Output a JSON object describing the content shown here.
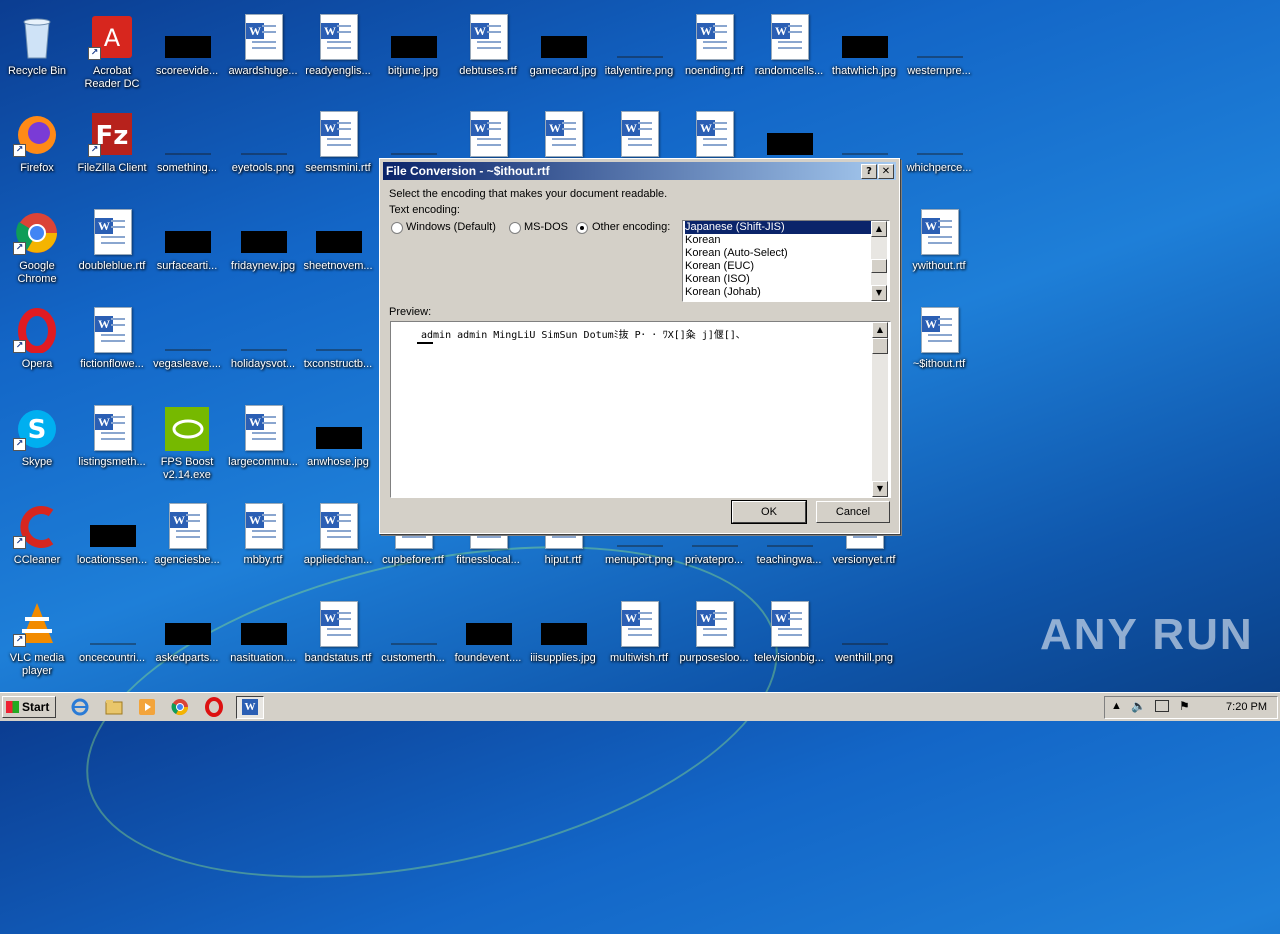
{
  "desktop": {
    "icons": [
      {
        "label": "Recycle Bin",
        "type": "recycle"
      },
      {
        "label": "Acrobat\nReader DC",
        "type": "acrobat"
      },
      {
        "label": "scoreevide...",
        "type": "black"
      },
      {
        "label": "awardshuge...",
        "type": "word"
      },
      {
        "label": "readyenglis...",
        "type": "word"
      },
      {
        "label": "bitjune.jpg",
        "type": "black"
      },
      {
        "label": "debtuses.rtf",
        "type": "word"
      },
      {
        "label": "gamecard.jpg",
        "type": "black"
      },
      {
        "label": "italyentire.png",
        "type": "thin"
      },
      {
        "label": "noending.rtf",
        "type": "word"
      },
      {
        "label": "randomcells...",
        "type": "word"
      },
      {
        "label": "thatwhich.jpg",
        "type": "black"
      },
      {
        "label": "westernpre...",
        "type": "thin"
      },
      {
        "label": "Firefox",
        "type": "firefox"
      },
      {
        "label": "FileZilla Client",
        "type": "filezilla"
      },
      {
        "label": "something...",
        "type": "thin"
      },
      {
        "label": "eyetools.png",
        "type": "thin"
      },
      {
        "label": "seemsmini.rtf",
        "type": "word"
      },
      {
        "label": "",
        "type": "thin"
      },
      {
        "label": "",
        "type": "word"
      },
      {
        "label": "",
        "type": "word"
      },
      {
        "label": "",
        "type": "word"
      },
      {
        "label": "",
        "type": "word"
      },
      {
        "label": "",
        "type": "black"
      },
      {
        "label": "",
        "type": "thin"
      },
      {
        "label": "whichperce...",
        "type": "thin"
      },
      {
        "label": "Google\nChrome",
        "type": "chrome"
      },
      {
        "label": "doubleblue.rtf",
        "type": "word"
      },
      {
        "label": "surfacearti...",
        "type": "black"
      },
      {
        "label": "fridaynew.jpg",
        "type": "black"
      },
      {
        "label": "sheetnovem...",
        "type": "black"
      },
      {
        "label": "ywithout.rtf",
        "type": "word"
      },
      {
        "label": "Opera",
        "type": "opera"
      },
      {
        "label": "fictionflowe...",
        "type": "word"
      },
      {
        "label": "vegasleave....",
        "type": "thin"
      },
      {
        "label": "holidaysvot...",
        "type": "thin"
      },
      {
        "label": "txconstructb...",
        "type": "thin"
      },
      {
        "label": "~$ithout.rtf",
        "type": "word"
      },
      {
        "label": "Skype",
        "type": "skype"
      },
      {
        "label": "listingsmeth...",
        "type": "word"
      },
      {
        "label": "FPS Boost\nv2.14.exe",
        "type": "nvidia"
      },
      {
        "label": "largecommu...",
        "type": "word"
      },
      {
        "label": "anwhose.jpg",
        "type": "black"
      },
      {
        "label": "CCleaner",
        "type": "ccleaner"
      },
      {
        "label": "locationssen...",
        "type": "black"
      },
      {
        "label": "agenciesbe...",
        "type": "word"
      },
      {
        "label": "mbby.rtf",
        "type": "word"
      },
      {
        "label": "appliedchan...",
        "type": "word"
      },
      {
        "label": "cupbefore.rtf",
        "type": "word"
      },
      {
        "label": "fitnesslocal...",
        "type": "word"
      },
      {
        "label": "hiput.rtf",
        "type": "word"
      },
      {
        "label": "menuport.png",
        "type": "thin"
      },
      {
        "label": "privatepro...",
        "type": "thin"
      },
      {
        "label": "teachingwa...",
        "type": "thin"
      },
      {
        "label": "versionyet.rtf",
        "type": "word"
      },
      {
        "label": "VLC media\nplayer",
        "type": "vlc"
      },
      {
        "label": "oncecountri...",
        "type": "thin"
      },
      {
        "label": "askedparts...",
        "type": "black"
      },
      {
        "label": "nasituation....",
        "type": "black"
      },
      {
        "label": "bandstatus.rtf",
        "type": "word"
      },
      {
        "label": "customerth...",
        "type": "thin"
      },
      {
        "label": "foundevent....",
        "type": "black"
      },
      {
        "label": "iiisupplies.jpg",
        "type": "black"
      },
      {
        "label": "multiwish.rtf",
        "type": "word"
      },
      {
        "label": "purposesloo...",
        "type": "word"
      },
      {
        "label": "televisionbig...",
        "type": "word"
      },
      {
        "label": "wenthill.png",
        "type": "thin"
      }
    ]
  },
  "dialog": {
    "title": "File Conversion - ~$ithout.rtf",
    "help_btn": "?",
    "close_btn": "✕",
    "instruction": "Select the encoding that makes your document readable.",
    "text_encoding_label": "Text encoding:",
    "radio_windows": "Windows (Default)",
    "radio_msdos": "MS-DOS",
    "radio_other": "Other encoding:",
    "selected_radio": "other",
    "encodings": [
      "Japanese (Shift-JIS)",
      "Korean",
      "Korean (Auto-Select)",
      "Korean (EUC)",
      "Korean (ISO)",
      "Korean (Johab)"
    ],
    "selected_encoding": "Japanese (Shift-JIS)",
    "preview_label": "Preview:",
    "preview_text": "admin admin MingLiU SimSun Dotumﾐ抜 P･ ･ ﾜX[]粂 j]偃[]､",
    "ok": "OK",
    "cancel": "Cancel"
  },
  "taskbar": {
    "start": "Start",
    "clock": "7:20 PM"
  },
  "watermark": "ANY RUN"
}
